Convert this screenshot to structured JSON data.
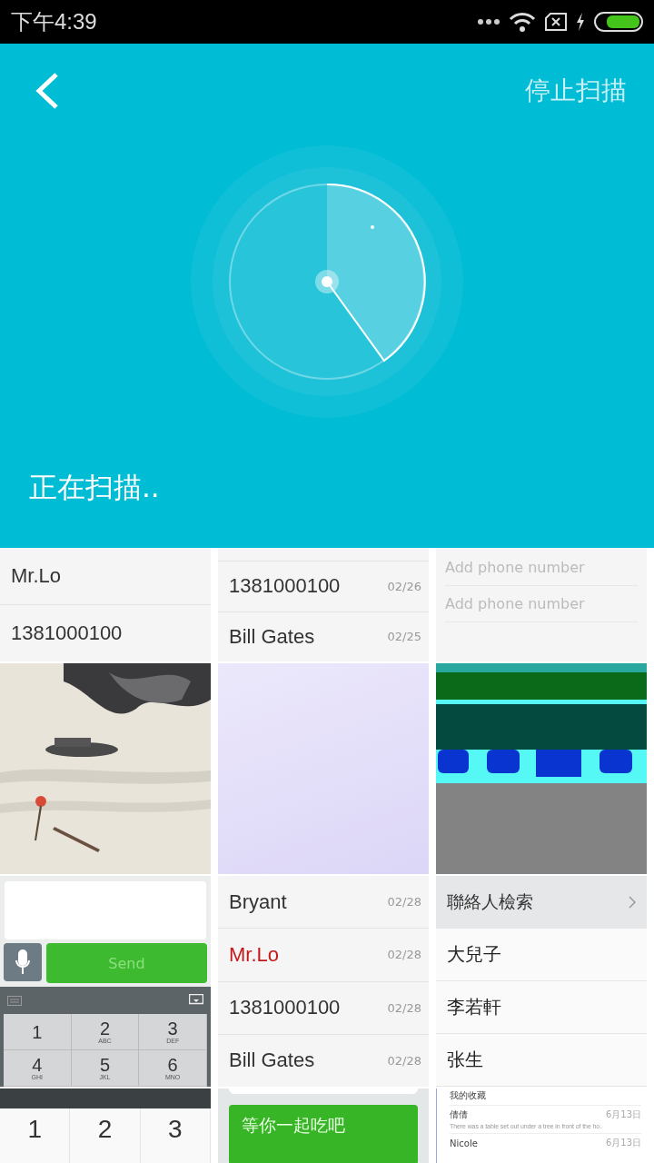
{
  "status_bar": {
    "time": "下午4:39"
  },
  "header": {
    "action": "停止扫描"
  },
  "scan": {
    "status": "正在扫描.."
  },
  "thumbnails": [
    {
      "kind": "contacts",
      "rows": [
        {
          "name": "Mr.Lo"
        },
        {
          "name": "1381000100"
        }
      ]
    },
    {
      "kind": "calls",
      "rows": [
        {
          "name": "1381000100",
          "date": "02/26",
          "missed": false
        },
        {
          "name": "Bill Gates",
          "date": "02/25",
          "missed": false
        }
      ]
    },
    {
      "kind": "form",
      "fields": [
        {
          "placeholder": "Add phone number"
        },
        {
          "placeholder": "Add phone number"
        }
      ]
    },
    {
      "kind": "picture"
    },
    {
      "kind": "blank"
    },
    {
      "kind": "picture"
    },
    {
      "kind": "composer",
      "button": "Send",
      "keys": [
        {
          "digit": "1"
        },
        {
          "digit": "2",
          "letters": "ABC"
        },
        {
          "digit": "3",
          "letters": "DEF"
        },
        {
          "digit": "4",
          "letters": "GHI"
        },
        {
          "digit": "5",
          "letters": "JKL"
        },
        {
          "digit": "6",
          "letters": "MNO"
        }
      ]
    },
    {
      "kind": "calls",
      "rows": [
        {
          "name": "Bryant",
          "date": "02/28",
          "missed": false
        },
        {
          "name": "Mr.Lo",
          "date": "02/28",
          "missed": true
        },
        {
          "name": "1381000100",
          "date": "02/28",
          "missed": false
        },
        {
          "name": "Bill Gates",
          "date": "02/28",
          "missed": false
        }
      ]
    },
    {
      "kind": "directory",
      "header": "聯絡人檢索",
      "names": [
        "大兒子",
        "李若軒",
        "张生"
      ]
    },
    {
      "kind": "dialpad",
      "keys": [
        "1",
        "2",
        "3"
      ]
    },
    {
      "kind": "chat",
      "message": "等你一起吃吧"
    },
    {
      "kind": "inbox",
      "top": "我的收藏",
      "rows": [
        {
          "sender": "倩倩",
          "date": "6月13日",
          "preview": "There was a table set out under a tree in front of the ho."
        },
        {
          "sender": "Nicole",
          "date": "6月13日"
        }
      ]
    }
  ]
}
